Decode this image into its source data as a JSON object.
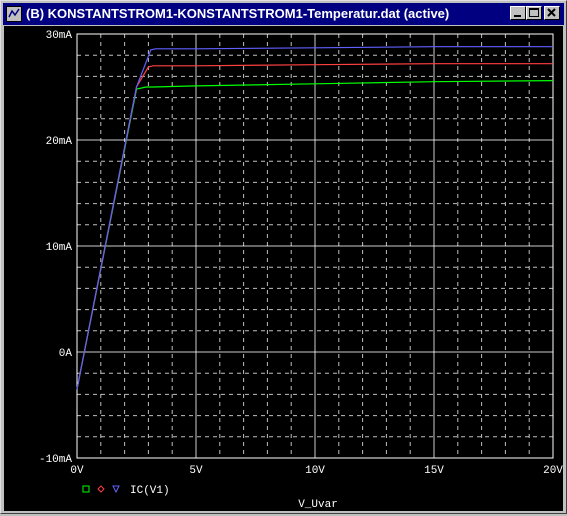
{
  "window": {
    "title": "(B) KONSTANTSTROM1-KONSTANTSTROM1-Temperatur.dat (active)",
    "buttons": [
      "minimize",
      "maximize",
      "close"
    ]
  },
  "colors": {
    "background": "#000000",
    "grid": "#ffffff",
    "series_green": "#00ff00",
    "series_red": "#ff4040",
    "series_blue": "#6060ff"
  },
  "chart_data": {
    "type": "line",
    "xlabel": "V_Uvar",
    "ylabel": "",
    "xlim": [
      0,
      20
    ],
    "ylim": [
      -10,
      30
    ],
    "x_ticks": [
      0,
      5,
      10,
      15,
      20
    ],
    "x_tick_labels": [
      "0V",
      "5V",
      "10V",
      "15V",
      "20V"
    ],
    "y_ticks": [
      -10,
      0,
      10,
      20,
      30
    ],
    "y_tick_labels": [
      "-10mA",
      "0A",
      "10mA",
      "20mA",
      "30mA"
    ],
    "grid": true,
    "legend_label": "IC(V1)",
    "legend_position": "bottom-left",
    "series": [
      {
        "color": "#00ff00",
        "marker": "square",
        "x": [
          0,
          2.5,
          2.9,
          3.2,
          5,
          10,
          15,
          20
        ],
        "y": [
          -3.5,
          24.8,
          25.0,
          25.0,
          25.1,
          25.3,
          25.5,
          25.6
        ]
      },
      {
        "color": "#ff4040",
        "marker": "diamond",
        "x": [
          0,
          2.5,
          3.0,
          3.2,
          5,
          10,
          15,
          20
        ],
        "y": [
          -3.5,
          25.0,
          26.9,
          27.0,
          27.0,
          27.1,
          27.2,
          27.2
        ]
      },
      {
        "color": "#6060ff",
        "marker": "triangle",
        "x": [
          0,
          2.5,
          3.1,
          3.3,
          5,
          10,
          15,
          20
        ],
        "y": [
          -3.5,
          25.0,
          28.5,
          28.6,
          28.6,
          28.7,
          28.8,
          28.8
        ]
      }
    ]
  }
}
